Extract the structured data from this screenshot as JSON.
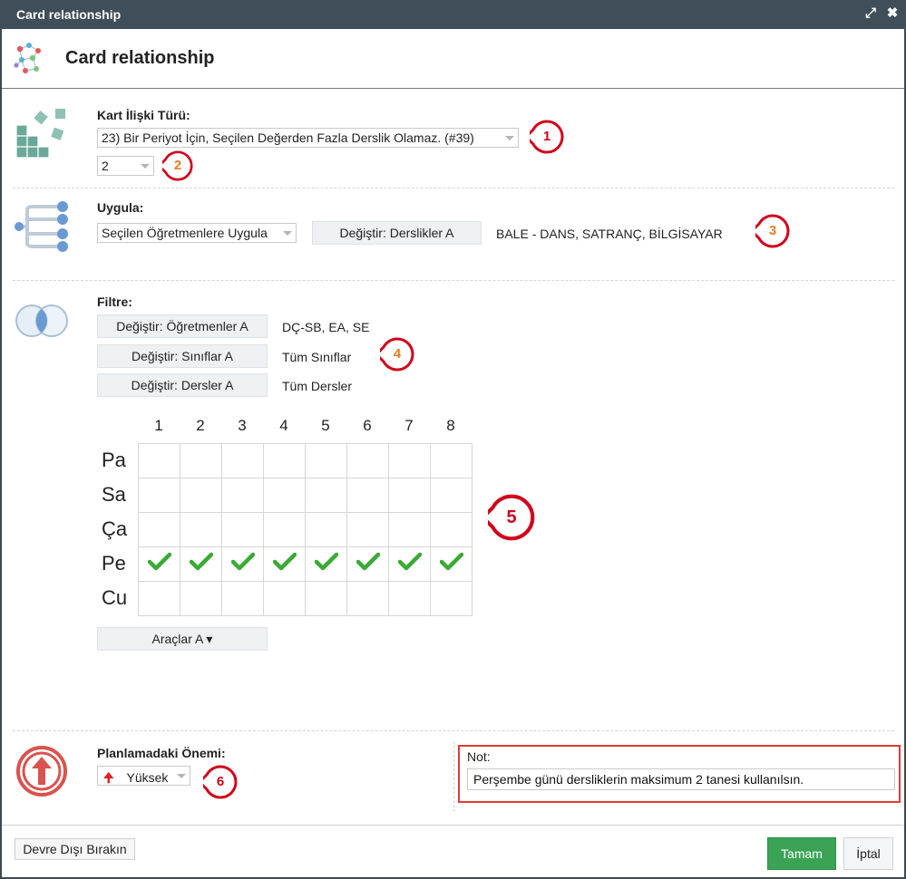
{
  "window": {
    "title": "Card relationship",
    "maximize_icon": "expand-icon",
    "close_icon": "close-icon"
  },
  "header": {
    "title": "Card relationship",
    "icon": "network-graph-icon"
  },
  "relation": {
    "label": "Kart İlişki Türü:",
    "type_value": "23) Bir Periyot İçin, Seçilen Değerden Fazla Derslik Olamaz. (#39)",
    "count_value": "2",
    "icon": "blocks-icon"
  },
  "apply": {
    "label": "Uygula:",
    "select_value": "Seçilen Öğretmenlere Uygula",
    "change_button": "Değiştir: Derslikler A",
    "selection_text": "BALE - DANS, SATRANÇ, BİLGİSAYAR",
    "icon": "branch-tree-icon"
  },
  "filter": {
    "label": "Filtre:",
    "icon": "venn-diagram-icon",
    "rows": [
      {
        "button": "Değiştir: Öğretmenler A",
        "value": "DÇ-SB, EA, SE"
      },
      {
        "button": "Değiştir: Sınıflar A",
        "value": "Tüm Sınıflar"
      },
      {
        "button": "Değiştir: Dersler A",
        "value": "Tüm Dersler"
      }
    ]
  },
  "schedule": {
    "periods": [
      "1",
      "2",
      "3",
      "4",
      "5",
      "6",
      "7",
      "8"
    ],
    "days": [
      "Pa",
      "Sa",
      "Ça",
      "Pe",
      "Cu"
    ],
    "checked": [
      [
        false,
        false,
        false,
        false,
        false,
        false,
        false,
        false
      ],
      [
        false,
        false,
        false,
        false,
        false,
        false,
        false,
        false
      ],
      [
        false,
        false,
        false,
        false,
        false,
        false,
        false,
        false
      ],
      [
        true,
        true,
        true,
        true,
        true,
        true,
        true,
        true
      ],
      [
        false,
        false,
        false,
        false,
        false,
        false,
        false,
        false
      ]
    ],
    "check_color": "#3aaa35",
    "tools_button": "Araçlar A ▾"
  },
  "importance": {
    "label": "Planlamadaki Önemi:",
    "value": "Yüksek",
    "icon": "arrow-up-circle-icon",
    "color": "#d9534f"
  },
  "note": {
    "label": "Not:",
    "value": "Perşembe günü dersliklerin maksimum 2 tanesi kullanılsın."
  },
  "markers": [
    "1",
    "2",
    "3",
    "4",
    "5",
    "6"
  ],
  "marker_color": "#d0021b",
  "footer": {
    "disable_button": "Devre Dışı Bırakın",
    "ok_button": "Tamam",
    "cancel_button": "İptal",
    "ok_color": "#3aa356"
  }
}
